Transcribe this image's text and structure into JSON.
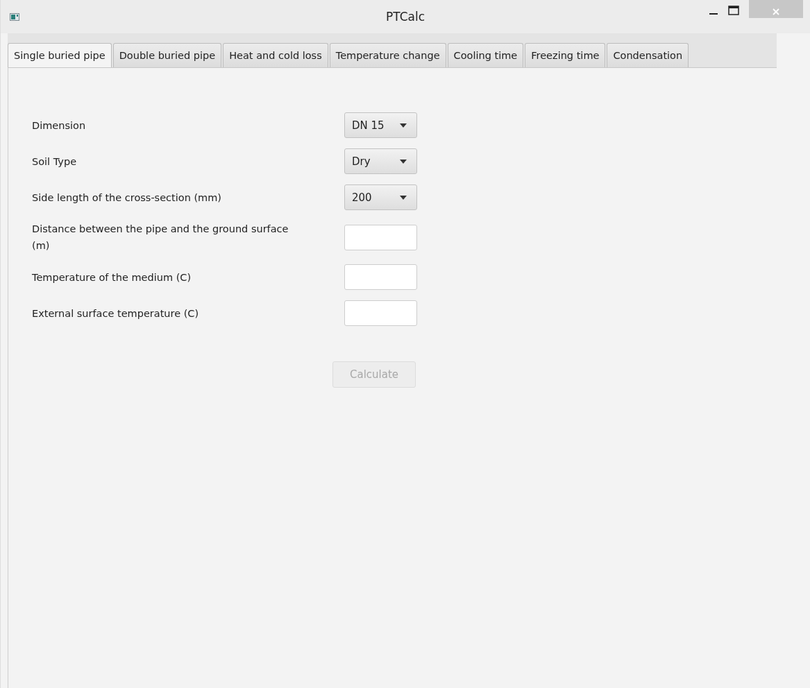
{
  "window": {
    "title": "PTCalc"
  },
  "tabs": [
    {
      "label": "Single buried pipe",
      "selected": true
    },
    {
      "label": "Double buried pipe",
      "selected": false
    },
    {
      "label": "Heat and cold loss",
      "selected": false
    },
    {
      "label": "Temperature change",
      "selected": false
    },
    {
      "label": "Cooling time",
      "selected": false
    },
    {
      "label": "Freezing time",
      "selected": false
    },
    {
      "label": "Condensation",
      "selected": false
    }
  ],
  "fields": [
    {
      "label": "Dimension",
      "kind": "dropdown",
      "value": "DN 15"
    },
    {
      "label": "Soil Type",
      "kind": "dropdown",
      "value": "Dry"
    },
    {
      "label": "Side length of the cross-section (mm)",
      "kind": "dropdown",
      "value": "200"
    },
    {
      "label": "Distance between the pipe and the ground surface (m)",
      "kind": "text"
    },
    {
      "label": "Temperature of the medium (C)",
      "kind": "text"
    },
    {
      "label": "External surface temperature (C)",
      "kind": "text"
    }
  ],
  "calculate_button": {
    "label": "Calculate",
    "disabled": true
  }
}
